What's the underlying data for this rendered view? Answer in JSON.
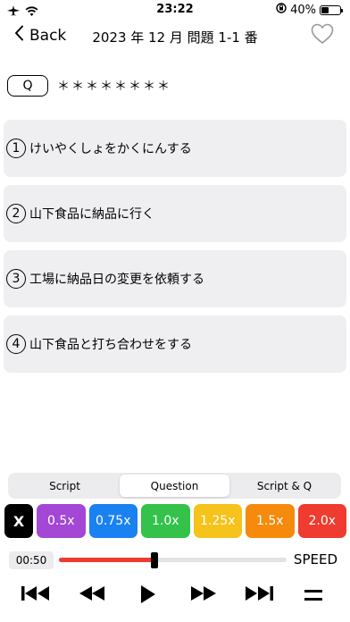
{
  "status": {
    "time": "23:22",
    "battery": "40%",
    "battery_level": 0.4
  },
  "nav": {
    "back_label": "Back",
    "title": "2023 年 12 月 問題 1-1 番"
  },
  "question": {
    "pill": "Q",
    "mask": "＊＊＊＊＊＊＊＊"
  },
  "options": [
    {
      "num": "1",
      "text": "けいやくしょをかくにんする"
    },
    {
      "num": "2",
      "text": "山下食品に納品に行く"
    },
    {
      "num": "3",
      "text": "工場に納品日の変更を依頼する"
    },
    {
      "num": "4",
      "text": "山下食品と打ち合わせをする"
    }
  ],
  "tabs": [
    {
      "label": "Script",
      "active": false
    },
    {
      "label": "Question",
      "active": true
    },
    {
      "label": "Script & Q",
      "active": false
    }
  ],
  "speeds": [
    {
      "label": "X",
      "color": "#000000"
    },
    {
      "label": "0.5x",
      "color": "#a347d4"
    },
    {
      "label": "0.75x",
      "color": "#1a82f0"
    },
    {
      "label": "1.0x",
      "color": "#34c24b"
    },
    {
      "label": "1.25x",
      "color": "#f6c31a"
    },
    {
      "label": "1.5x",
      "color": "#f58a0c"
    },
    {
      "label": "2.0x",
      "color": "#ef3b30"
    }
  ],
  "player": {
    "current_time": "00:50",
    "progress": 0.42,
    "speed_label": "SPEED",
    "accent": "#ee3b31"
  }
}
